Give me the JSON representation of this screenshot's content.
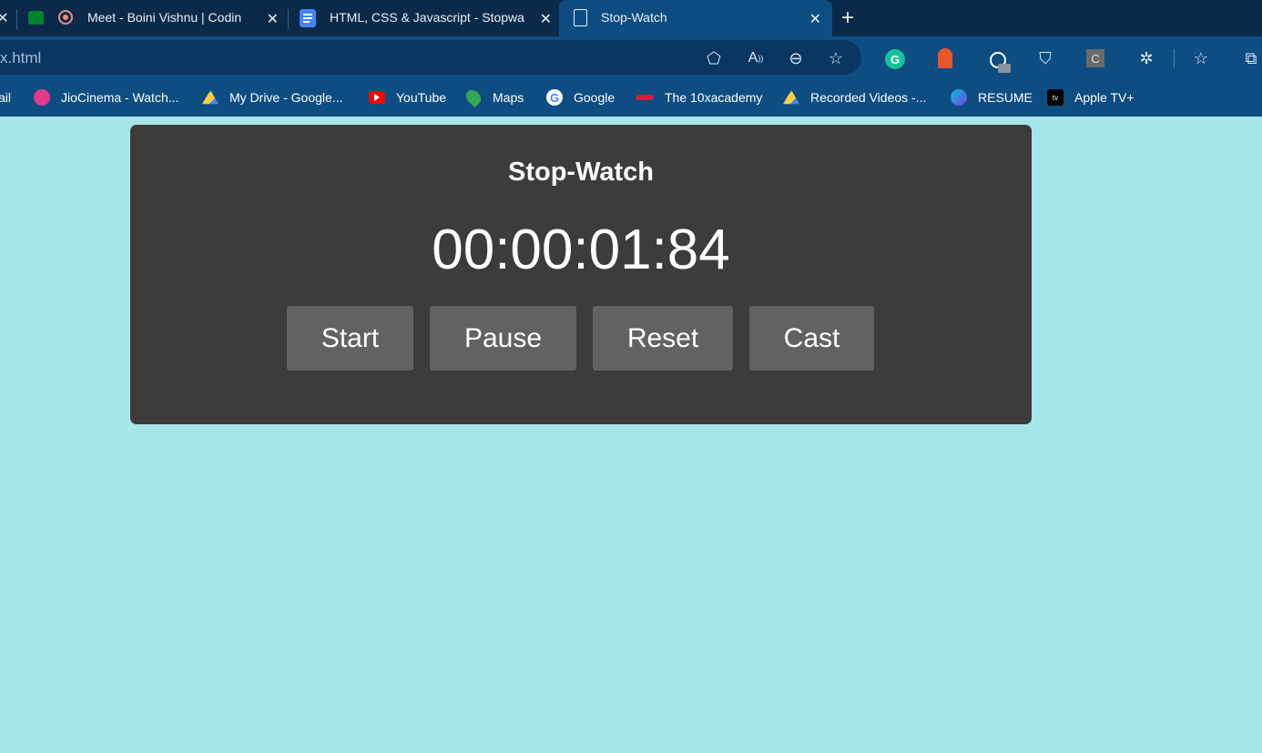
{
  "browser": {
    "tabs": [
      {
        "title": "Meet - Boini Vishnu | Codin",
        "active": false
      },
      {
        "title": "HTML, CSS & Javascript - Stopwa",
        "active": false
      },
      {
        "title": "Stop-Watch",
        "active": true
      }
    ],
    "url": "x.html",
    "bookmarks": [
      {
        "label": "ail",
        "icon": "gmail-icon"
      },
      {
        "label": "JioCinema - Watch...",
        "icon": "jiocinema-icon",
        "color": "#e23a8c"
      },
      {
        "label": "My Drive - Google...",
        "icon": "google-drive-icon",
        "color": "#1fa463"
      },
      {
        "label": "YouTube",
        "icon": "youtube-icon",
        "color": "#ff0000"
      },
      {
        "label": "Maps",
        "icon": "maps-pin-icon",
        "color": "#34a853"
      },
      {
        "label": "Google",
        "icon": "google-icon",
        "color": "#ffffff"
      },
      {
        "label": "The 10xacademy",
        "icon": "10x-icon",
        "color": "#d6203a"
      },
      {
        "label": "Recorded Videos -...",
        "icon": "google-drive-icon",
        "color": "#1fa463"
      },
      {
        "label": "RESUME",
        "icon": "canva-icon",
        "color": "#7d3cf0"
      },
      {
        "label": "Apple TV+",
        "icon": "apple-tv-icon",
        "color": "#000000"
      }
    ],
    "extensions": {
      "c_label": "C"
    }
  },
  "app": {
    "title": "Stop-Watch",
    "time": "00:00:01:84",
    "buttons": {
      "start": "Start",
      "pause": "Pause",
      "reset": "Reset",
      "cast": "Cast"
    }
  },
  "colors": {
    "page_bg": "#a6e6eb",
    "panel_bg": "#3e3c3a",
    "button_bg": "#626262",
    "text": "#ffffff"
  }
}
